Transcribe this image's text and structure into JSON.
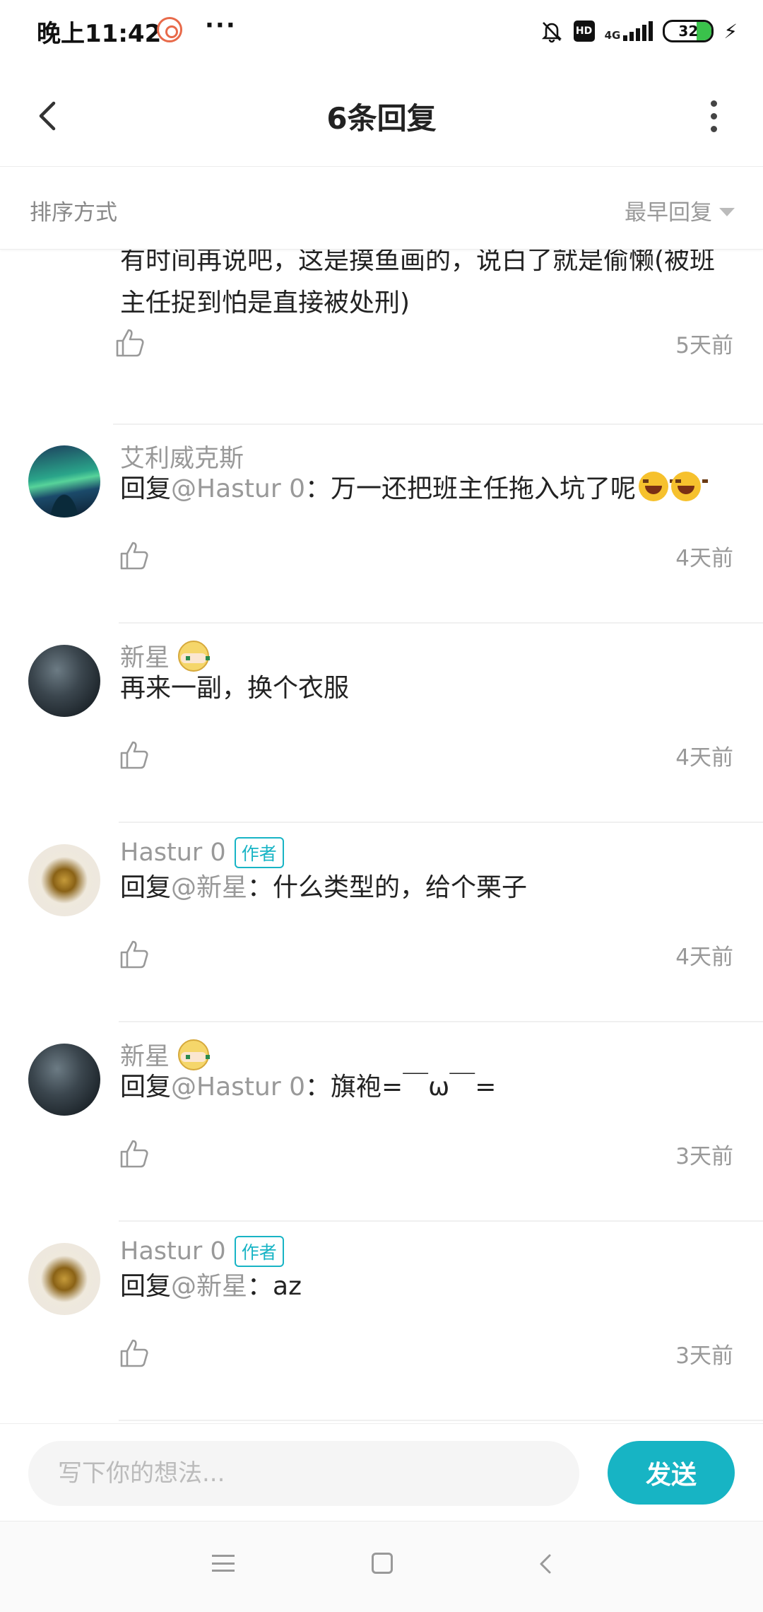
{
  "status_bar": {
    "time": "晚上11:42",
    "dots": "···",
    "hd": "HD",
    "network": "4G",
    "battery": "32",
    "battery_level": 0.32
  },
  "header": {
    "title": "6条回复"
  },
  "sort": {
    "label": "排序方式",
    "selected": "最早回复"
  },
  "replies": [
    {
      "author": "",
      "content": "有时间再说吧，这是摸鱼画的，说白了就是偷懒(被班主任捉到怕是直接被处刑)",
      "time": "5天前"
    },
    {
      "author": "艾利威克斯",
      "prefix": "回复",
      "mention": "@Hastur 0",
      "text": "：万一还把班主任拖入坑了呢",
      "time": "4天前"
    },
    {
      "author": "新星",
      "content": "再来一副，换个衣服",
      "time": "4天前"
    },
    {
      "author": "Hastur 0",
      "badge": "作者",
      "prefix": "回复",
      "mention": "@新星",
      "text": "：什么类型的，给个栗子",
      "time": "4天前"
    },
    {
      "author": "新星",
      "prefix": "回复",
      "mention": "@Hastur 0",
      "text": "：旗袍=￣ω￣=",
      "time": "3天前"
    },
    {
      "author": "Hastur 0",
      "badge": "作者",
      "prefix": "回复",
      "mention": "@新星",
      "text": "：az",
      "time": "3天前"
    }
  ],
  "input": {
    "placeholder": "写下你的想法...",
    "value": "",
    "send_label": "发送"
  },
  "colors": {
    "accent": "#17b4c4",
    "muted_text": "#999999",
    "battery_green": "#3ac24b"
  }
}
